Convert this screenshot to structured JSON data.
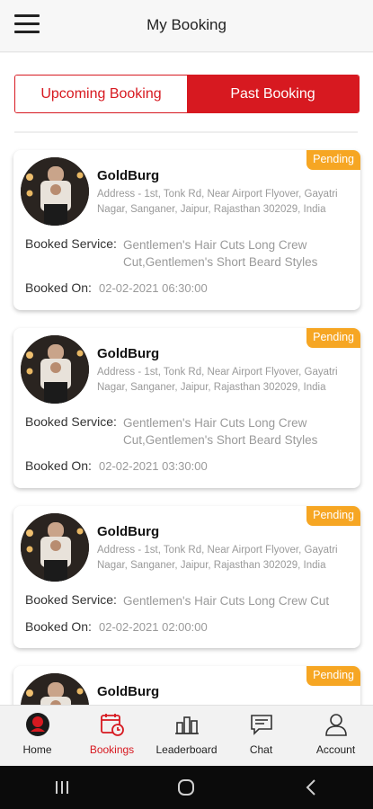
{
  "header": {
    "title": "My Booking"
  },
  "tabs": [
    {
      "label": "Upcoming Booking",
      "active": false
    },
    {
      "label": "Past Booking",
      "active": true
    }
  ],
  "labels": {
    "booked_service": "Booked Service:",
    "booked_on": "Booked On:"
  },
  "bookings": [
    {
      "status": "Pending",
      "name": "GoldBurg",
      "address": "Address - 1st, Tonk Rd, Near Airport Flyover, Gayatri Nagar, Sanganer, Jaipur, Rajasthan 302029, India",
      "service": "Gentlemen's Hair Cuts Long Crew Cut,Gentlemen's Short Beard Styles",
      "booked_on": "02-02-2021 06:30:00"
    },
    {
      "status": "Pending",
      "name": "GoldBurg",
      "address": "Address - 1st, Tonk Rd, Near Airport Flyover, Gayatri Nagar, Sanganer, Jaipur, Rajasthan 302029, India",
      "service": "Gentlemen's Hair Cuts Long Crew Cut,Gentlemen's Short Beard Styles",
      "booked_on": "02-02-2021 03:30:00"
    },
    {
      "status": "Pending",
      "name": "GoldBurg",
      "address": "Address - 1st, Tonk Rd, Near Airport Flyover, Gayatri Nagar, Sanganer, Jaipur, Rajasthan 302029, India",
      "service": "Gentlemen's Hair Cuts Long Crew Cut",
      "booked_on": "02-02-2021 02:00:00"
    },
    {
      "status": "Pending",
      "name": "GoldBurg"
    }
  ],
  "bottom_nav": [
    {
      "label": "Home",
      "icon": "barber-home-icon",
      "active": false
    },
    {
      "label": "Bookings",
      "icon": "calendar-clock-icon",
      "active": true
    },
    {
      "label": "Leaderboard",
      "icon": "leaderboard-icon",
      "active": false
    },
    {
      "label": "Chat",
      "icon": "chat-icon",
      "active": false
    },
    {
      "label": "Account",
      "icon": "account-icon",
      "active": false
    }
  ],
  "colors": {
    "accent": "#d71920",
    "badge": "#f6a623",
    "muted": "#9a9a9a"
  }
}
